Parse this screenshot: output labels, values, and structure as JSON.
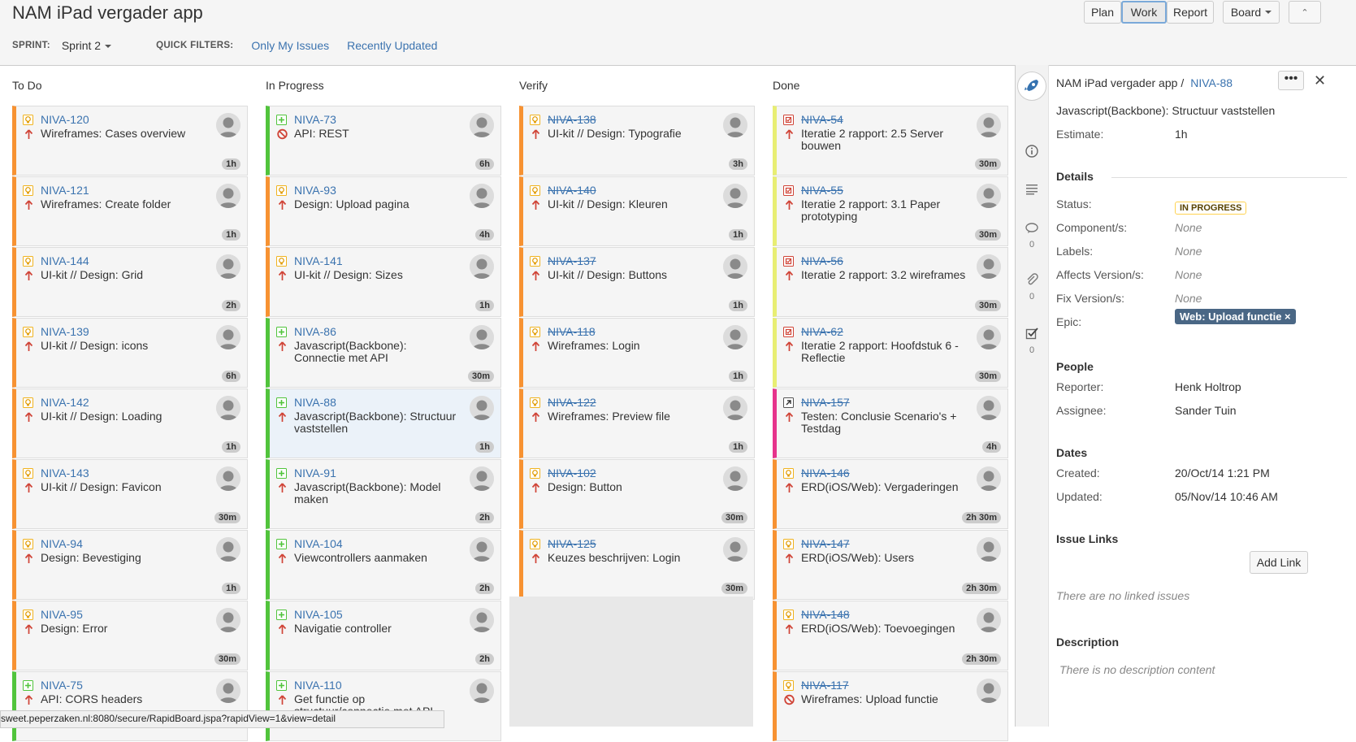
{
  "header": {
    "title": "NAM iPad vergader app",
    "sprint_label": "SPRINT:",
    "sprint_value": "Sprint 2",
    "quick_filters_label": "QUICK FILTERS:",
    "filters": [
      "Only My Issues",
      "Recently Updated"
    ],
    "buttons": {
      "plan": "Plan",
      "work": "Work",
      "report": "Report",
      "board": "Board"
    },
    "active_mode": "Work"
  },
  "columns": [
    {
      "name": "To Do",
      "cards": [
        {
          "key": "NIVA-120",
          "summary": "Wireframes: Cases overview",
          "estimate": "1h",
          "type": "improvement",
          "done": false,
          "blocked": false
        },
        {
          "key": "NIVA-121",
          "summary": "Wireframes: Create folder",
          "estimate": "1h",
          "type": "improvement",
          "done": false,
          "blocked": false
        },
        {
          "key": "NIVA-144",
          "summary": "UI-kit // Design: Grid",
          "estimate": "2h",
          "type": "improvement",
          "done": false,
          "blocked": false
        },
        {
          "key": "NIVA-139",
          "summary": "UI-kit // Design: icons",
          "estimate": "6h",
          "type": "improvement",
          "done": false,
          "blocked": false
        },
        {
          "key": "NIVA-142",
          "summary": "UI-kit // Design: Loading",
          "estimate": "1h",
          "type": "improvement",
          "done": false,
          "blocked": false
        },
        {
          "key": "NIVA-143",
          "summary": "UI-kit // Design: Favicon",
          "estimate": "30m",
          "type": "improvement",
          "done": false,
          "blocked": false
        },
        {
          "key": "NIVA-94",
          "summary": "Design: Bevestiging",
          "estimate": "1h",
          "type": "improvement",
          "done": false,
          "blocked": false
        },
        {
          "key": "NIVA-95",
          "summary": "Design: Error",
          "estimate": "30m",
          "type": "improvement",
          "done": false,
          "blocked": false
        },
        {
          "key": "NIVA-75",
          "summary": "API: CORS headers",
          "estimate": "",
          "type": "new-feature",
          "done": false,
          "blocked": false
        }
      ]
    },
    {
      "name": "In Progress",
      "cards": [
        {
          "key": "NIVA-73",
          "summary": "API: REST",
          "estimate": "6h",
          "type": "new-feature",
          "done": false,
          "blocked": true
        },
        {
          "key": "NIVA-93",
          "summary": "Design: Upload pagina",
          "estimate": "4h",
          "type": "improvement",
          "done": false,
          "blocked": false
        },
        {
          "key": "NIVA-141",
          "summary": "UI-kit // Design: Sizes",
          "estimate": "1h",
          "type": "improvement",
          "done": false,
          "blocked": false
        },
        {
          "key": "NIVA-86",
          "summary": "Javascript(Backbone): Connectie met API",
          "estimate": "30m",
          "type": "new-feature",
          "done": false,
          "blocked": false
        },
        {
          "key": "NIVA-88",
          "summary": "Javascript(Backbone): Structuur vaststellen",
          "estimate": "1h",
          "type": "new-feature",
          "done": false,
          "blocked": false,
          "selected": true
        },
        {
          "key": "NIVA-91",
          "summary": "Javascript(Backbone): Model maken",
          "estimate": "2h",
          "type": "new-feature",
          "done": false,
          "blocked": false
        },
        {
          "key": "NIVA-104",
          "summary": "Viewcontrollers aanmaken",
          "estimate": "2h",
          "type": "new-feature",
          "done": false,
          "blocked": false
        },
        {
          "key": "NIVA-105",
          "summary": "Navigatie controller",
          "estimate": "2h",
          "type": "new-feature",
          "done": false,
          "blocked": false
        },
        {
          "key": "NIVA-110",
          "summary": "Get functie op structuur/connectie met API",
          "estimate": "",
          "type": "new-feature",
          "done": false,
          "blocked": false
        }
      ]
    },
    {
      "name": "Verify",
      "cards": [
        {
          "key": "NIVA-138",
          "summary": "UI-kit // Design: Typografie",
          "estimate": "3h",
          "type": "improvement",
          "done": true,
          "blocked": false
        },
        {
          "key": "NIVA-140",
          "summary": "UI-kit // Design: Kleuren",
          "estimate": "1h",
          "type": "improvement",
          "done": true,
          "blocked": false
        },
        {
          "key": "NIVA-137",
          "summary": "UI-kit // Design: Buttons",
          "estimate": "1h",
          "type": "improvement",
          "done": true,
          "blocked": false
        },
        {
          "key": "NIVA-118",
          "summary": "Wireframes: Login",
          "estimate": "1h",
          "type": "improvement",
          "done": true,
          "blocked": false
        },
        {
          "key": "NIVA-122",
          "summary": "Wireframes: Preview file",
          "estimate": "1h",
          "type": "improvement",
          "done": true,
          "blocked": false
        },
        {
          "key": "NIVA-102",
          "summary": "Design: Button",
          "estimate": "30m",
          "type": "improvement",
          "done": true,
          "blocked": false
        },
        {
          "key": "NIVA-125",
          "summary": "Keuzes beschrijven: Login",
          "estimate": "30m",
          "type": "improvement",
          "done": true,
          "blocked": false
        }
      ]
    },
    {
      "name": "Done",
      "cards": [
        {
          "key": "NIVA-54",
          "summary": "Iteratie 2 rapport: 2.5 Server bouwen",
          "estimate": "30m",
          "type": "task",
          "done": true,
          "blocked": false
        },
        {
          "key": "NIVA-55",
          "summary": "Iteratie 2 rapport: 3.1 Paper prototyping",
          "estimate": "30m",
          "type": "task",
          "done": true,
          "blocked": false
        },
        {
          "key": "NIVA-56",
          "summary": "Iteratie 2 rapport: 3.2 wireframes",
          "estimate": "30m",
          "type": "task",
          "done": true,
          "blocked": false
        },
        {
          "key": "NIVA-62",
          "summary": "Iteratie 2 rapport: Hoofdstuk 6 - Reflectie",
          "estimate": "30m",
          "type": "task",
          "done": true,
          "blocked": false
        },
        {
          "key": "NIVA-157",
          "summary": "Testen: Conclusie Scenario's + Testdag",
          "estimate": "4h",
          "type": "sub-task",
          "done": true,
          "blocked": false
        },
        {
          "key": "NIVA-146",
          "summary": "ERD(iOS/Web): Vergaderingen",
          "estimate": "2h 30m",
          "type": "improvement",
          "done": true,
          "blocked": false
        },
        {
          "key": "NIVA-147",
          "summary": "ERD(iOS/Web): Users",
          "estimate": "2h 30m",
          "type": "improvement",
          "done": true,
          "blocked": false
        },
        {
          "key": "NIVA-148",
          "summary": "ERD(iOS/Web): Toevoegingen",
          "estimate": "2h 30m",
          "type": "improvement",
          "done": true,
          "blocked": false
        },
        {
          "key": "NIVA-117",
          "summary": "Wireframes: Upload functie",
          "estimate": "",
          "type": "improvement",
          "done": true,
          "blocked": true
        }
      ]
    }
  ],
  "statusbar": "sweet.peperzaken.nl:8080/secure/RapidBoard.jspa?rapidView=1&view=detail",
  "detail": {
    "project": "NAM iPad vergader app",
    "separator": "/",
    "issue_key": "NIVA-88",
    "more": "•••",
    "close": "✕",
    "summary": "Javascript(Backbone): Structuur vaststellen",
    "estimate_label": "Estimate:",
    "estimate_value": "1h",
    "details_title": "Details",
    "status_label": "Status:",
    "status_value": "IN PROGRESS",
    "components_label": "Component/s:",
    "components_value": "None",
    "labels_label": "Labels:",
    "labels_value": "None",
    "affects_label": "Affects Version/s:",
    "affects_value": "None",
    "fix_label": "Fix Version/s:",
    "fix_value": "None",
    "epic_label": "Epic:",
    "epic_value": "Web: Upload functie ×",
    "people_title": "People",
    "reporter_label": "Reporter:",
    "reporter_value": "Henk Holtrop",
    "assignee_label": "Assignee:",
    "assignee_value": "Sander Tuin",
    "dates_title": "Dates",
    "created_label": "Created:",
    "created_value": "20/Oct/14 1:21 PM",
    "updated_label": "Updated:",
    "updated_value": "05/Nov/14 10:46 AM",
    "links_title": "Issue Links",
    "add_link": "Add Link",
    "no_links": "There are no linked issues",
    "description_title": "Description",
    "no_description": "There is no description content"
  },
  "side_nav": {
    "comments_count": "0",
    "attachments_count": "0",
    "subtasks_count": "0"
  },
  "colors": {
    "link": "#3b73af",
    "todo_border": "#f79232",
    "in_progress_border": "#59afe1",
    "feature_green": "#51c43c",
    "done_yellow": "#e8ee73",
    "subtask_pink": "#e6338c",
    "epic_bg": "#4a6785"
  }
}
